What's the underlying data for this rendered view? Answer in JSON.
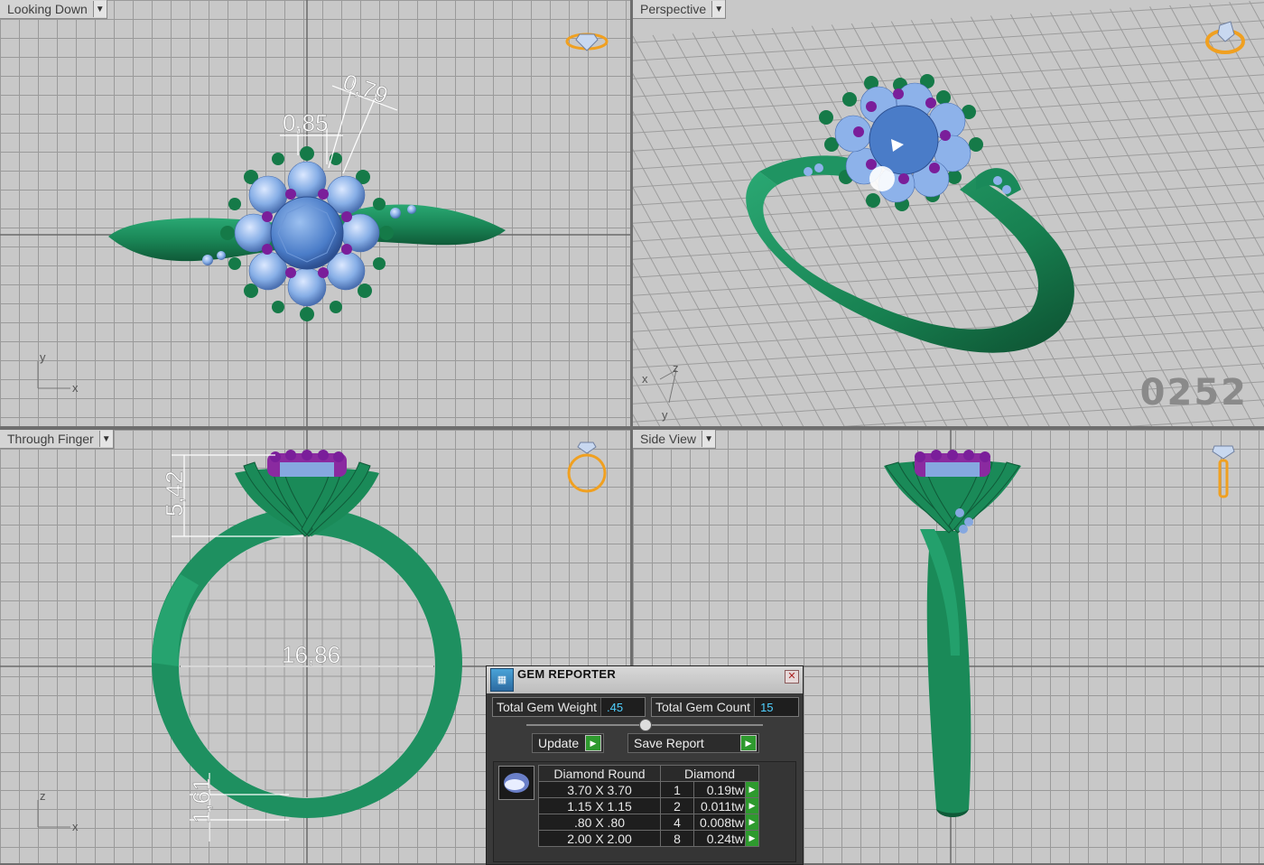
{
  "viewports": {
    "top_left": {
      "label": "Looking Down"
    },
    "top_right": {
      "label": "Perspective",
      "reference_number": "0252"
    },
    "bottom_left": {
      "label": "Through Finger"
    },
    "bottom_right": {
      "label": "Side View"
    }
  },
  "dimensions": {
    "top_view": [
      "0,85",
      "0,79"
    ],
    "front_view": [
      "5,42",
      "16,86",
      "1,61"
    ]
  },
  "axes": {
    "top_view": [
      "y",
      "x"
    ],
    "perspective": [
      "x",
      "z",
      "y"
    ],
    "front_view": [
      "z",
      "x"
    ]
  },
  "gem_reporter": {
    "title": "GEM REPORTER",
    "close": "✕",
    "total_weight_label": "Total Gem Weight",
    "total_weight_value": ".45",
    "total_count_label": "Total Gem Count",
    "total_count_value": "15",
    "update_label": "Update",
    "save_report_label": "Save Report",
    "table": {
      "headers": [
        "Diamond Round",
        "Diamond"
      ],
      "rows": [
        {
          "size": "3.70 X 3.70",
          "count": "1",
          "weight": "0.19tw"
        },
        {
          "size": "1.15 X 1.15",
          "count": "2",
          "weight": "0.011tw"
        },
        {
          "size": ".80 X .80",
          "count": "4",
          "weight": "0.008tw"
        },
        {
          "size": "2.00 X 2.00",
          "count": "8",
          "weight": "0.24tw"
        }
      ]
    }
  },
  "colors": {
    "metal": "#1f8a5a",
    "gem": "#7fa8e0",
    "center_gem": "#4a7cc8",
    "prong": "#1c7a4a",
    "accent_prong": "#8a2aa0",
    "viewport_bg": "#c8c8c8",
    "grid": "#9a9a9a"
  }
}
